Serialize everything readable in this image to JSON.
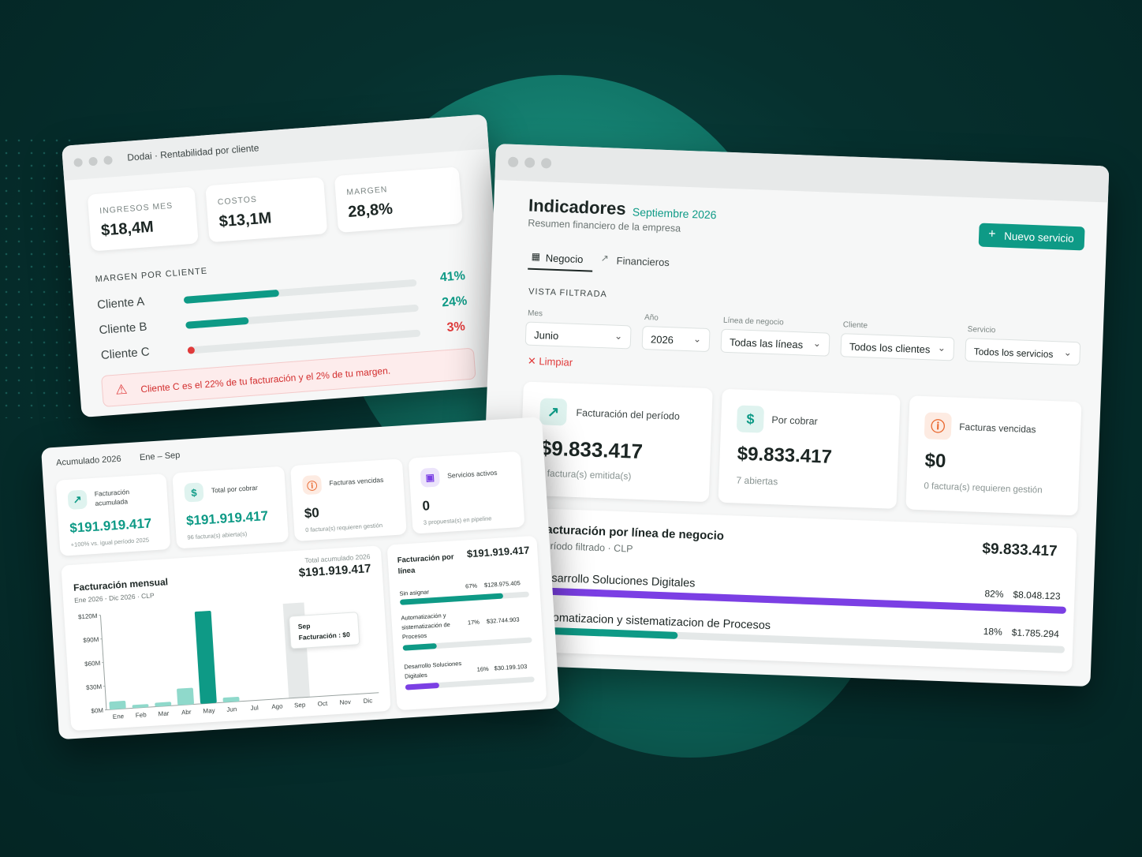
{
  "colors": {
    "accent": "#0e9a86",
    "danger": "#e03a3a",
    "purple": "#7b3fe4",
    "warn": "#e9662c"
  },
  "rent": {
    "title": "Dodai · Rentabilidad por cliente",
    "kpis": [
      {
        "label": "INGRESOS MES",
        "value": "$18,4M"
      },
      {
        "label": "COSTOS",
        "value": "$13,1M"
      },
      {
        "label": "MARGEN",
        "value": "28,8%"
      }
    ],
    "section": "MARGEN POR CLIENTE",
    "clients": [
      {
        "name": "Cliente A",
        "pct": "41%",
        "fill": 0.41
      },
      {
        "name": "Cliente B",
        "pct": "24%",
        "fill": 0.24
      },
      {
        "name": "Cliente C",
        "pct": "3%",
        "fill": 0.03
      }
    ],
    "alert": "Cliente C es el 22% de tu facturación y el 2% de tu margen."
  },
  "acum": {
    "title": "Acumulado 2026",
    "range": "Ene – Sep",
    "kpis": [
      {
        "label": "Facturación acumulada",
        "value": "$191.919.417",
        "sub": "+100% vs. igual período 2025",
        "icon": "trend-up-icon"
      },
      {
        "label": "Total por cobrar",
        "value": "$191.919.417",
        "sub": "96 factura(s) abierta(s)",
        "icon": "dollar-icon"
      },
      {
        "label": "Facturas vencidas",
        "value": "$0",
        "sub": "0 factura(s) requieren gestión",
        "icon": "alert-icon"
      },
      {
        "label": "Servicios activos",
        "value": "0",
        "sub": "3 propuesta(s) en pipeline",
        "icon": "briefcase-icon"
      }
    ],
    "monthly": {
      "title": "Facturación mensual",
      "sub": "Ene 2026 - Dic 2026 · CLP",
      "total_label": "Total acumulado 2026",
      "total": "$191.919.417",
      "tooltip_month": "Sep",
      "tooltip_value": "Facturación : $0"
    },
    "lines": {
      "title": "Facturación por línea",
      "total": "$191.919.417",
      "items": [
        {
          "name": "Sin asignar",
          "pct": "67%",
          "value": "$128.975.405",
          "fill": 0.67,
          "color": "#0e9a86"
        },
        {
          "name": "Automatización y sistematización de Procesos",
          "pct": "17%",
          "value": "$32.744.903",
          "fill": 0.17,
          "color": "#0e9a86"
        },
        {
          "name": "Desarrollo Soluciones Digitales",
          "pct": "16%",
          "value": "$30.199.103",
          "fill": 0.16,
          "color": "#7b3fe4"
        }
      ]
    }
  },
  "chart_data": {
    "type": "bar",
    "categories": [
      "Ene",
      "Feb",
      "Mar",
      "Abr",
      "May",
      "Jun",
      "Jul",
      "Ago",
      "Sep",
      "Oct",
      "Nov",
      "Dic"
    ],
    "values": [
      10,
      4,
      5,
      21,
      117,
      6,
      0,
      0,
      0,
      0,
      0,
      0
    ],
    "highlight": [
      0,
      0,
      0,
      0,
      1,
      0,
      0,
      0,
      0,
      0,
      0,
      0
    ],
    "y_ticks": [
      "$0M",
      "$30M",
      "$60M",
      "$90M",
      "$120M"
    ],
    "ylim": [
      0,
      120
    ],
    "grid": false
  },
  "ind": {
    "title": "Indicadores",
    "period": "Septiembre 2026",
    "subtitle": "Resumen financiero de la empresa",
    "new_button": "Nuevo servicio",
    "tabs": [
      {
        "label": "Negocio",
        "active": true
      },
      {
        "label": "Financieros",
        "active": false
      }
    ],
    "filtered_label": "VISTA FILTRADA",
    "filters": [
      {
        "label": "Mes",
        "value": "Junio"
      },
      {
        "label": "Año",
        "value": "2026"
      },
      {
        "label": "Línea de negocio",
        "value": "Todas las líneas"
      },
      {
        "label": "Cliente",
        "value": "Todos los clientes"
      },
      {
        "label": "Servicio",
        "value": "Todos los servicios"
      }
    ],
    "clear": "Limpiar",
    "kpis": [
      {
        "label": "Facturación del período",
        "value": "$9.833.417",
        "sub": "7 factura(s) emitida(s)",
        "icon": "trend-up-icon"
      },
      {
        "label": "Por cobrar",
        "value": "$9.833.417",
        "sub": "7 abiertas",
        "icon": "dollar-icon"
      },
      {
        "label": "Facturas vencidas",
        "value": "$0",
        "sub": "0 factura(s) requieren gestión",
        "icon": "alert-icon"
      }
    ],
    "lines": {
      "title": "Facturación por línea de negocio",
      "sub": "Período filtrado · CLP",
      "total": "$9.833.417",
      "items": [
        {
          "name": "Desarrollo Soluciones Digitales",
          "pct": "82%",
          "value": "$8.048.123",
          "fill": 1.0,
          "color": "#7b3fe4"
        },
        {
          "name": "Automatizacion y sistematizacion de Procesos",
          "pct": "18%",
          "value": "$1.785.294",
          "fill": 0.27,
          "color": "#0e9a86"
        }
      ]
    }
  }
}
